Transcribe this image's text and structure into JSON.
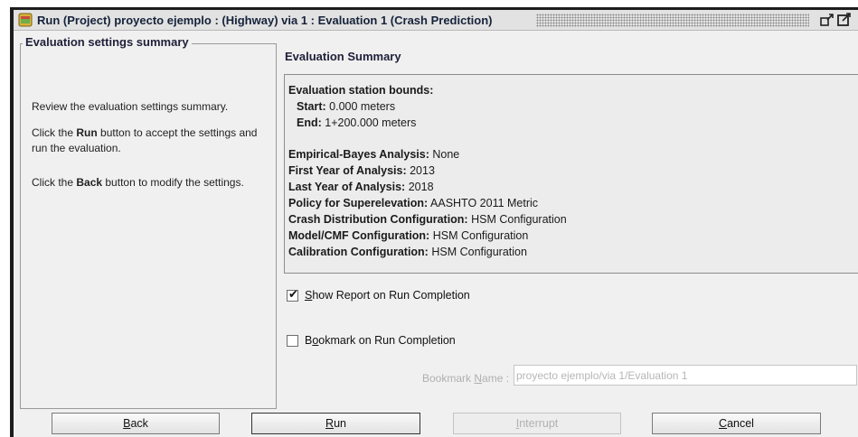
{
  "window": {
    "title": "Run (Project) proyecto ejemplo : (Highway) via 1 : Evaluation 1 (Crash Prediction)"
  },
  "left_panel": {
    "title": "Evaluation settings summary",
    "para1": "Review the evaluation settings summary.",
    "para2_pre": "Click the ",
    "para2_bold": "Run",
    "para2_post": " button to accept the settings and run the evaluation.",
    "para3_pre": "Click the ",
    "para3_bold": "Back",
    "para3_post": " button to modify the settings."
  },
  "summary": {
    "heading": "Evaluation Summary",
    "bounds_label": "Evaluation station bounds:",
    "start_label": "Start:",
    "start_value": "0.000 meters",
    "end_label": "End:",
    "end_value": "1+200.000 meters",
    "rows": [
      {
        "label": "Empirical-Bayes Analysis:",
        "value": "None"
      },
      {
        "label": "First Year of Analysis:",
        "value": "2013"
      },
      {
        "label": "Last Year of Analysis:",
        "value": "2018"
      },
      {
        "label": "Policy for Superelevation:",
        "value": "AASHTO 2011 Metric"
      },
      {
        "label": "Crash Distribution Configuration:",
        "value": "HSM Configuration"
      },
      {
        "label": "Model/CMF Configuration:",
        "value": "HSM Configuration"
      },
      {
        "label": "Calibration Configuration:",
        "value": "HSM Configuration"
      }
    ]
  },
  "options": {
    "show_report": {
      "mnemonic": "S",
      "rest": "how Report on Run Completion",
      "checked": true
    },
    "bookmark": {
      "first": "B",
      "mnemonic": "o",
      "rest": "okmark on Run Completion",
      "checked": false
    },
    "bookmark_name": {
      "label_pre": "Bookmark ",
      "label_mnemonic": "N",
      "label_post": "ame :",
      "value": "proyecto ejemplo/via 1/Evaluation 1"
    }
  },
  "buttons": {
    "back": {
      "mnemonic": "B",
      "rest": "ack"
    },
    "run": {
      "mnemonic": "R",
      "rest": "un"
    },
    "interrupt": {
      "mnemonic": "I",
      "rest": "nterrupt"
    },
    "cancel": {
      "mnemonic": "C",
      "rest": "ancel"
    }
  }
}
